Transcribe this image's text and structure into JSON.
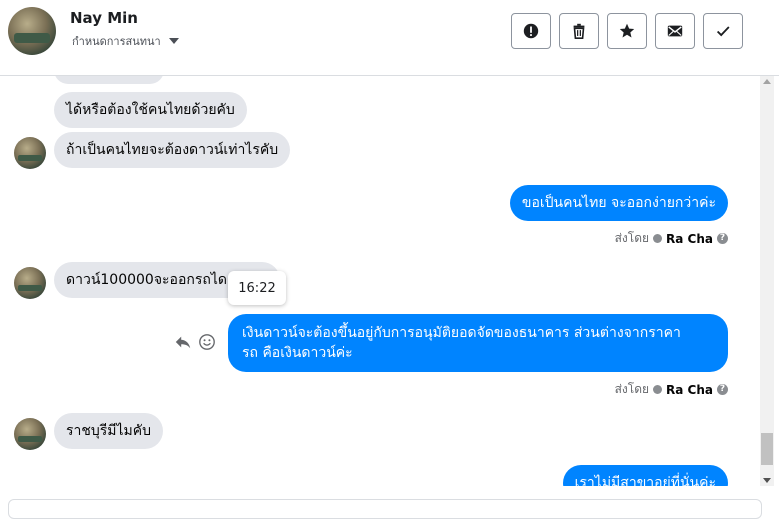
{
  "header": {
    "contact_name": "Nay Min",
    "subtitle": "กำหนดการสนทนา",
    "actions": [
      {
        "name": "report-button",
        "icon": "exclamation-icon"
      },
      {
        "name": "delete-button",
        "icon": "trash-icon"
      },
      {
        "name": "star-button",
        "icon": "star-icon"
      },
      {
        "name": "mark-unread-button",
        "icon": "envelope-icon"
      },
      {
        "name": "done-button",
        "icon": "check-icon"
      }
    ]
  },
  "messages": {
    "m1": "ได้หรือต้องใช้คนไทยด้วยคับ",
    "m2": "ถ้าเป็นคนไทยจะต้องดาวน์เท่าไรคับ",
    "m3": "ขอเป็นคนไทย จะออกง่ายกว่าค่ะ",
    "m4": "ดาวน์100000จะออกรถได",
    "m5_line1": "เงินดาวน์จะต้องขึ้นอยู่กับการอนุมัติยอดจัดของธนาคาร ส่วนต่างจากราคา",
    "m5_line2": "รถ คือเงินดาวน์ค่ะ",
    "m6": "ราชบุรีมีไมคับ",
    "m7": "เราไม่มีสาขาอยู่ที่นั่นค่ะ"
  },
  "sent_by": {
    "label": "ส่งโดย",
    "name": "Ra Cha",
    "help": "?"
  },
  "tooltip": {
    "time": "16:22"
  },
  "colors": {
    "outgoing_bubble": "#0084ff",
    "incoming_bubble": "#e4e6eb"
  }
}
